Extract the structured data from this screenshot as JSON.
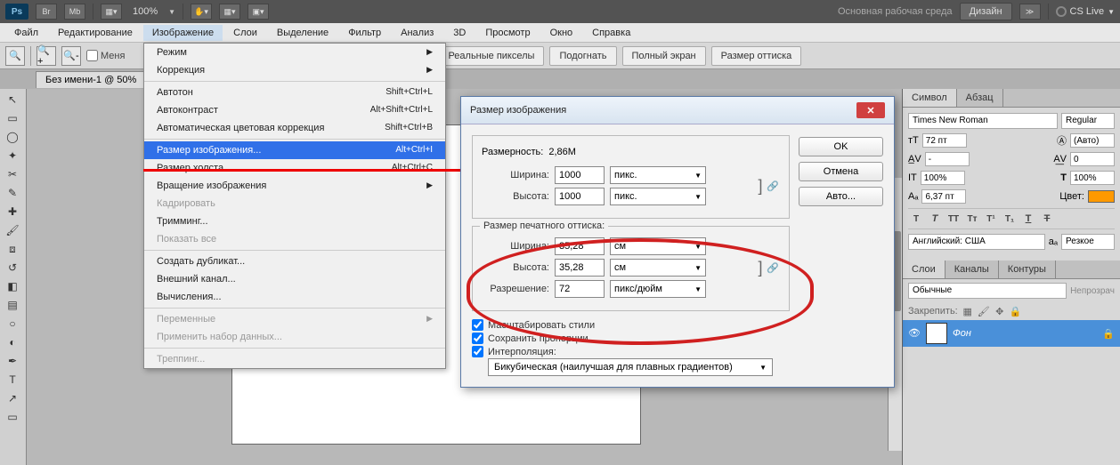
{
  "appbar": {
    "zoom": "100%",
    "workspace_label": "Основная рабочая среда",
    "design_btn": "Дизайн",
    "cs_live": "CS Live"
  },
  "menubar": {
    "items": [
      "Файл",
      "Редактирование",
      "Изображение",
      "Слои",
      "Выделение",
      "Фильтр",
      "Анализ",
      "3D",
      "Просмотр",
      "Окно",
      "Справка"
    ]
  },
  "optbar": {
    "change_windows": "Меня",
    "buttons": [
      "Реальные пикселы",
      "Подогнать",
      "Полный экран",
      "Размер оттиска"
    ]
  },
  "doctab": "Без имени-1 @ 50%",
  "dropdown": {
    "groups": [
      [
        {
          "label": "Режим",
          "arrow": true
        },
        {
          "label": "Коррекция",
          "arrow": true
        }
      ],
      [
        {
          "label": "Автотон",
          "shortcut": "Shift+Ctrl+L"
        },
        {
          "label": "Автоконтраст",
          "shortcut": "Alt+Shift+Ctrl+L"
        },
        {
          "label": "Автоматическая цветовая коррекция",
          "shortcut": "Shift+Ctrl+B"
        }
      ],
      [
        {
          "label": "Размер изображения...",
          "shortcut": "Alt+Ctrl+I",
          "highlight": true
        },
        {
          "label": "Размер холста...",
          "shortcut": "Alt+Ctrl+C"
        },
        {
          "label": "Вращение изображения",
          "arrow": true
        },
        {
          "label": "Кадрировать",
          "disabled": true
        },
        {
          "label": "Тримминг..."
        },
        {
          "label": "Показать все",
          "disabled": true
        }
      ],
      [
        {
          "label": "Создать дубликат..."
        },
        {
          "label": "Внешний канал..."
        },
        {
          "label": "Вычисления..."
        }
      ],
      [
        {
          "label": "Переменные",
          "arrow": true,
          "disabled": true
        },
        {
          "label": "Применить набор данных...",
          "disabled": true
        }
      ],
      [
        {
          "label": "Треппинг...",
          "disabled": true
        }
      ]
    ]
  },
  "dialog": {
    "title": "Размер изображения",
    "dimensions_label": "Размерность:",
    "dimensions_value": "2,86M",
    "pixel_group": {
      "width_label": "Ширина:",
      "width_value": "1000",
      "height_label": "Высота:",
      "height_value": "1000",
      "unit": "пикс."
    },
    "print_group": {
      "legend": "Размер печатного оттиска:",
      "width_label": "Ширина:",
      "width_value": "35,28",
      "height_label": "Высота:",
      "height_value": "35,28",
      "unit": "см",
      "res_label": "Разрешение:",
      "res_value": "72",
      "res_unit": "пикс/дюйм"
    },
    "checks": {
      "scale_styles": "Масштабировать стили",
      "constrain": "Сохранить пропорции",
      "resample": "Интерполяция:"
    },
    "interp": "Бикубическая (наилучшая для плавных градиентов)",
    "buttons": {
      "ok": "OK",
      "cancel": "Отмена",
      "auto": "Авто..."
    }
  },
  "char_panel": {
    "tabs": [
      "Символ",
      "Абзац"
    ],
    "font": "Times New Roman",
    "style": "Regular",
    "size": "72 пт",
    "leading": "(Авто)",
    "tracking": "0",
    "scale_v": "100%",
    "scale_h": "100%",
    "baseline": "6,37 пт",
    "color_label": "Цвет:",
    "lang": "Английский: США",
    "aa": "Резкое"
  },
  "layers_panel": {
    "tabs": [
      "Слои",
      "Каналы",
      "Контуры"
    ],
    "blend": "Обычные",
    "opacity_label": "Непрозрач",
    "lock_label": "Закрепить:",
    "layer_name": "Фон"
  }
}
